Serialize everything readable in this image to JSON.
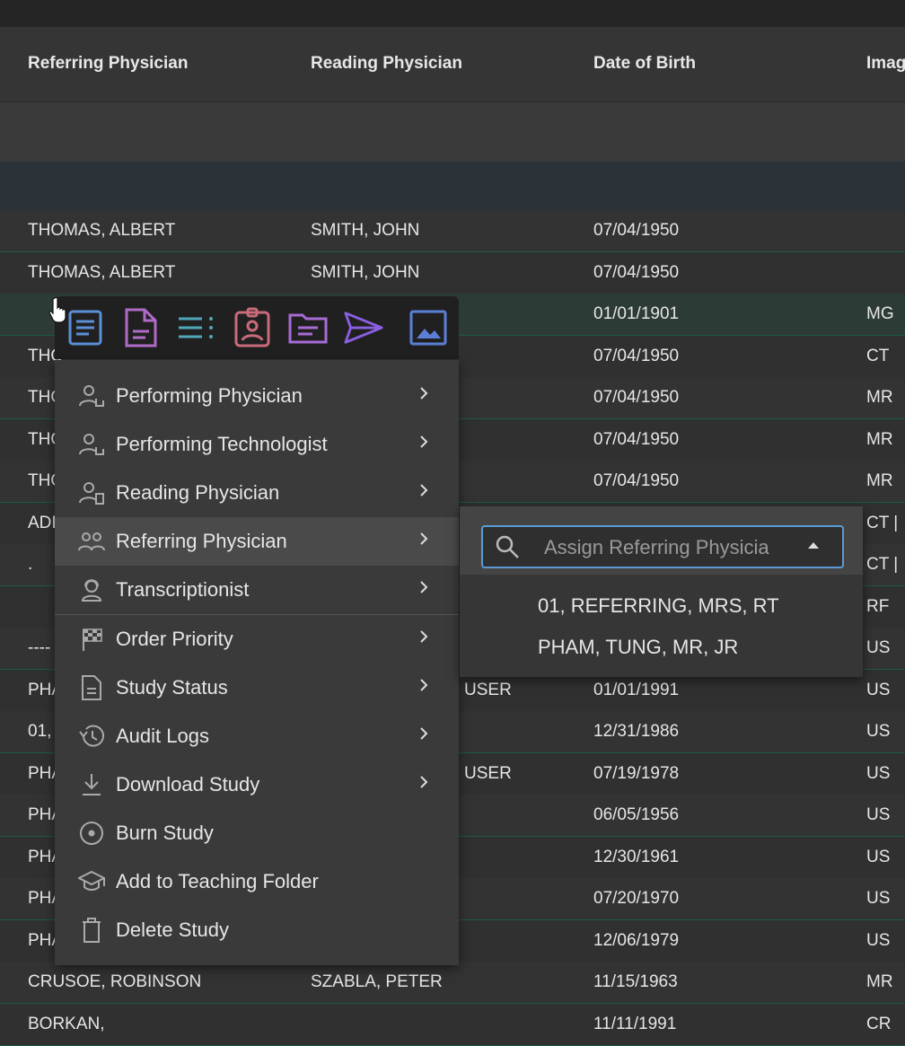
{
  "columns": {
    "referring": "Referring Physician",
    "reading": "Reading Physician",
    "dob": "Date of Birth",
    "imaging": "Imag"
  },
  "rows": [
    {
      "ref": "THOMAS, ALBERT",
      "read": "SMITH, JOHN",
      "read2": "",
      "dob": "07/04/1950",
      "img": ""
    },
    {
      "ref": "THOMAS, ALBERT",
      "read": "SMITH, JOHN",
      "read2": "",
      "dob": "07/04/1950",
      "img": ""
    },
    {
      "ref": "",
      "read": "",
      "read2": "",
      "dob": "01/01/1901",
      "img": "MG"
    },
    {
      "ref": "THO",
      "read": "",
      "read2": "",
      "dob": "07/04/1950",
      "img": "CT"
    },
    {
      "ref": "THO",
      "read": "",
      "read2": "",
      "dob": "07/04/1950",
      "img": "MR"
    },
    {
      "ref": "THO",
      "read": "",
      "read2": "",
      "dob": "07/04/1950",
      "img": "MR"
    },
    {
      "ref": "THO",
      "read": "",
      "read2": "",
      "dob": "07/04/1950",
      "img": "MR"
    },
    {
      "ref": "ADI",
      "read": "",
      "read2": "",
      "dob": "",
      "img": "CT | "
    },
    {
      "ref": ".",
      "read": "",
      "read2": "",
      "dob": "",
      "img": "CT | "
    },
    {
      "ref": "",
      "read": "",
      "read2": "",
      "dob": "",
      "img": "RF"
    },
    {
      "ref": "----",
      "read": "",
      "read2": "",
      "dob": "",
      "img": "US"
    },
    {
      "ref": "PHA",
      "read": "",
      "read2": "USER",
      "dob": "01/01/1991",
      "img": "US"
    },
    {
      "ref": "01,",
      "read": "",
      "read2": "",
      "dob": "12/31/1986",
      "img": "US"
    },
    {
      "ref": "PHA",
      "read": "",
      "read2": "USER",
      "dob": "07/19/1978",
      "img": "US"
    },
    {
      "ref": "PHA",
      "read": "",
      "read2": "",
      "dob": "06/05/1956",
      "img": "US"
    },
    {
      "ref": "PHA",
      "read": "",
      "read2": "",
      "dob": "12/30/1961",
      "img": "US"
    },
    {
      "ref": "PHA",
      "read": "",
      "read2": "",
      "dob": "07/20/1970",
      "img": "US"
    },
    {
      "ref": "PHA",
      "read": "",
      "read2": "",
      "dob": "12/06/1979",
      "img": "US"
    },
    {
      "ref": "CRUSOE, ROBINSON",
      "read": "SZABLA, PETER",
      "read2": "",
      "dob": "11/15/1963",
      "img": "MR"
    },
    {
      "ref": "BORKAN,",
      "read": "",
      "read2": "",
      "dob": "11/11/1991",
      "img": "CR"
    }
  ],
  "context_menu": {
    "items": [
      {
        "label": "Performing Physician",
        "icon": "performing-physician-icon",
        "has_submenu": true
      },
      {
        "label": "Performing Technologist",
        "icon": "performing-technologist-icon",
        "has_submenu": true
      },
      {
        "label": "Reading Physician",
        "icon": "reading-physician-icon",
        "has_submenu": true
      },
      {
        "label": "Referring Physician",
        "icon": "referring-physician-icon",
        "has_submenu": true
      },
      {
        "label": "Transcriptionist",
        "icon": "transcriptionist-icon",
        "has_submenu": true
      },
      {
        "label": "Order Priority",
        "icon": "checkered-flag-icon",
        "has_submenu": true
      },
      {
        "label": "Study Status",
        "icon": "document-icon",
        "has_submenu": true
      },
      {
        "label": "Audit Logs",
        "icon": "history-icon",
        "has_submenu": true
      },
      {
        "label": "Download Study",
        "icon": "download-icon",
        "has_submenu": true
      },
      {
        "label": "Burn Study",
        "icon": "disc-icon",
        "has_submenu": false
      },
      {
        "label": "Add to Teaching Folder",
        "icon": "graduation-cap-icon",
        "has_submenu": false
      },
      {
        "label": "Delete Study",
        "icon": "trash-icon",
        "has_submenu": false
      }
    ]
  },
  "quick_actions": [
    {
      "icon": "report-icon",
      "color": "#5b8fd6"
    },
    {
      "icon": "document-icon",
      "color": "#b06bc7"
    },
    {
      "icon": "list-icon",
      "color": "#4fa8b8"
    },
    {
      "icon": "patient-id-icon",
      "color": "#c96b7a"
    },
    {
      "icon": "folder-icon",
      "color": "#a76bd6"
    },
    {
      "icon": "send-icon",
      "color": "#8a5fe0"
    },
    {
      "icon": "image-icon",
      "color": "#5b7fd6"
    }
  ],
  "submenu": {
    "search_placeholder": "Assign Referring Physicia",
    "options": [
      "01, REFERRING, MRS, RT",
      "PHAM, TUNG, MR, JR"
    ]
  },
  "colors": {
    "accent": "#5b9bd5",
    "row_border": "#1e5a45"
  }
}
